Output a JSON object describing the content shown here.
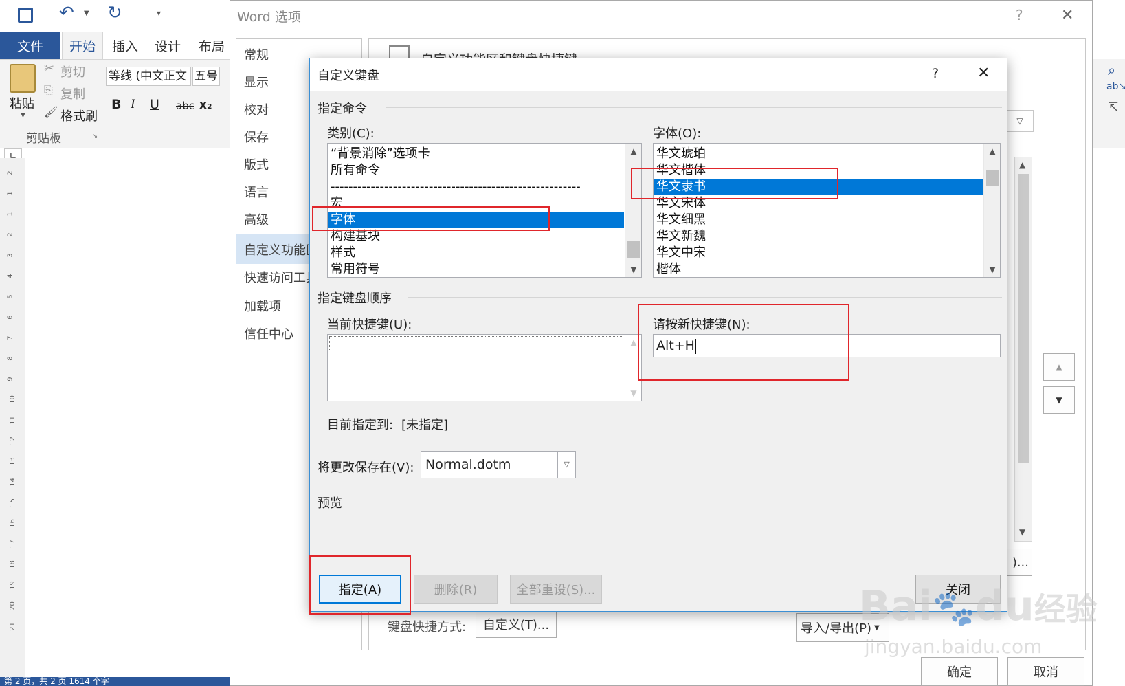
{
  "word": {
    "tabs": [
      "文件",
      "开始",
      "插入",
      "设计",
      "布局"
    ],
    "ribbon": {
      "paste": "粘贴",
      "cut": "剪切",
      "copy": "复制",
      "format_painter": "格式刷",
      "clipboard_group": "剪贴板",
      "font_name": "等线 (中文正文",
      "font_size": "五号",
      "bold": "B",
      "italic": "I",
      "underline": "U",
      "strike": "abc",
      "subscript": "x₂"
    },
    "status_text": "第 2 页，共 2 页    1614 个字",
    "ruler_numbers": [
      "2",
      "1",
      "1",
      "2",
      "3",
      "4",
      "5",
      "6",
      "7",
      "8",
      "9",
      "10",
      "11",
      "12",
      "13",
      "14",
      "15",
      "16",
      "17",
      "18",
      "19",
      "20",
      "21"
    ]
  },
  "options_dialog": {
    "title": "Word 选项",
    "help": "?",
    "close": "✕",
    "nav": [
      "常规",
      "显示",
      "校对",
      "保存",
      "版式",
      "语言",
      "高级",
      "自定义功能区",
      "快速访问工具栏",
      "加载项",
      "信任中心"
    ],
    "main_heading": "自定义功能区和键盘快捷键",
    "keyboard_shortcuts_label": "键盘快捷方式:",
    "customize_button": "自定义(T)...",
    "import_export_button": "导入/导出(P)",
    "ok_button": "确定",
    "cancel_button": "取消"
  },
  "keyboard_dialog": {
    "title": "自定义键盘",
    "help": "?",
    "close": "✕",
    "specify_command": "指定命令",
    "categories_label": "类别(C):",
    "categories": [
      "“背景消除”选项卡",
      "所有命令",
      "--------------------------------------------------------",
      "宏",
      "字体",
      "构建基块",
      "样式",
      "常用符号"
    ],
    "categories_selected": "字体",
    "fonts_label": "字体(O):",
    "fonts": [
      "华文琥珀",
      "华文楷体",
      "华文隶书",
      "华文宋体",
      "华文细黑",
      "华文新魏",
      "华文中宋",
      "楷体"
    ],
    "fonts_selected": "华文隶书",
    "specify_sequence": "指定键盘顺序",
    "current_keys_label": "当前快捷键(U):",
    "new_key_label": "请按新快捷键(N):",
    "new_key_value": "Alt+H",
    "currently_assigned_label": "目前指定到:",
    "currently_assigned_value": "[未指定]",
    "save_in_label": "将更改保存在(V):",
    "save_in_value": "Normal.dotm",
    "preview_label": "预览",
    "assign_button": "指定(A)",
    "remove_button": "删除(R)",
    "reset_all_button": "全部重设(S)...",
    "close_button": "关闭"
  },
  "watermark": "Baidu经验 jingyan.baidu.com",
  "colors": {
    "accent": "#2b579a",
    "selection": "#0078d7",
    "highlight": "#e0262b"
  }
}
